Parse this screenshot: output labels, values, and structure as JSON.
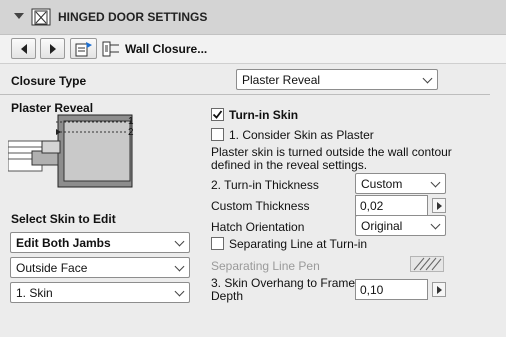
{
  "header": {
    "title": "HINGED DOOR SETTINGS"
  },
  "toolbar": {
    "section_label": "Wall Closure..."
  },
  "closure_type": {
    "label": "Closure Type",
    "value": "Plaster Reveal"
  },
  "preview": {
    "title": "Plaster Reveal",
    "marker1": "1",
    "marker2": "2"
  },
  "select_skin": {
    "label": "Select Skin to Edit",
    "jambs_value": "Edit Both Jambs",
    "face_value": "Outside Face",
    "skin_value": "1. Skin"
  },
  "turnin": {
    "label": "Turn-in Skin",
    "checked": true,
    "consider_label": "1. Consider Skin as Plaster",
    "consider_checked": false,
    "info_line1": "Plaster skin is turned outside the wall contour",
    "info_line2": "defined in the reveal settings."
  },
  "thickness": {
    "label": "2. Turn-in Thickness",
    "value": "Custom"
  },
  "custom_thickness": {
    "label": "Custom Thickness",
    "value": "0,02"
  },
  "hatch": {
    "label": "Hatch Orientation",
    "value": "Original"
  },
  "separating_line": {
    "label": "Separating Line at Turn-in",
    "checked": false
  },
  "separating_pen": {
    "label": "Separating Line Pen"
  },
  "overhang": {
    "label_line1": "3. Skin Overhang to Frame",
    "label_line2": "Depth",
    "value": "0,10"
  }
}
